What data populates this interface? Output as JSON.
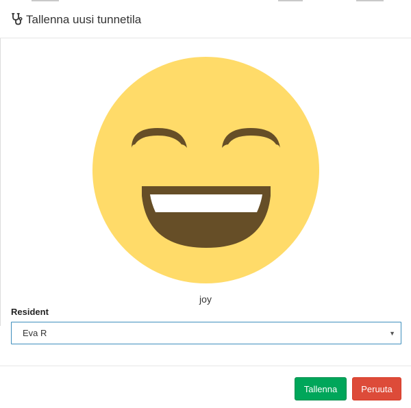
{
  "header": {
    "title": "Tallenna uusi tunnetila",
    "icon": "stethoscope-icon"
  },
  "emotion": {
    "label": "joy",
    "icon": "grinning-face-icon",
    "colors": {
      "face": "#FFDB69",
      "features": "#664E27",
      "teeth": "#FFFFFF"
    }
  },
  "form": {
    "resident_label": "Resident",
    "resident_value": "Eva R"
  },
  "footer": {
    "save_label": "Tallenna",
    "cancel_label": "Peruuta"
  },
  "colors": {
    "save": "#00a65a",
    "cancel": "#dd4b39",
    "select_border": "#3c8dbc"
  }
}
